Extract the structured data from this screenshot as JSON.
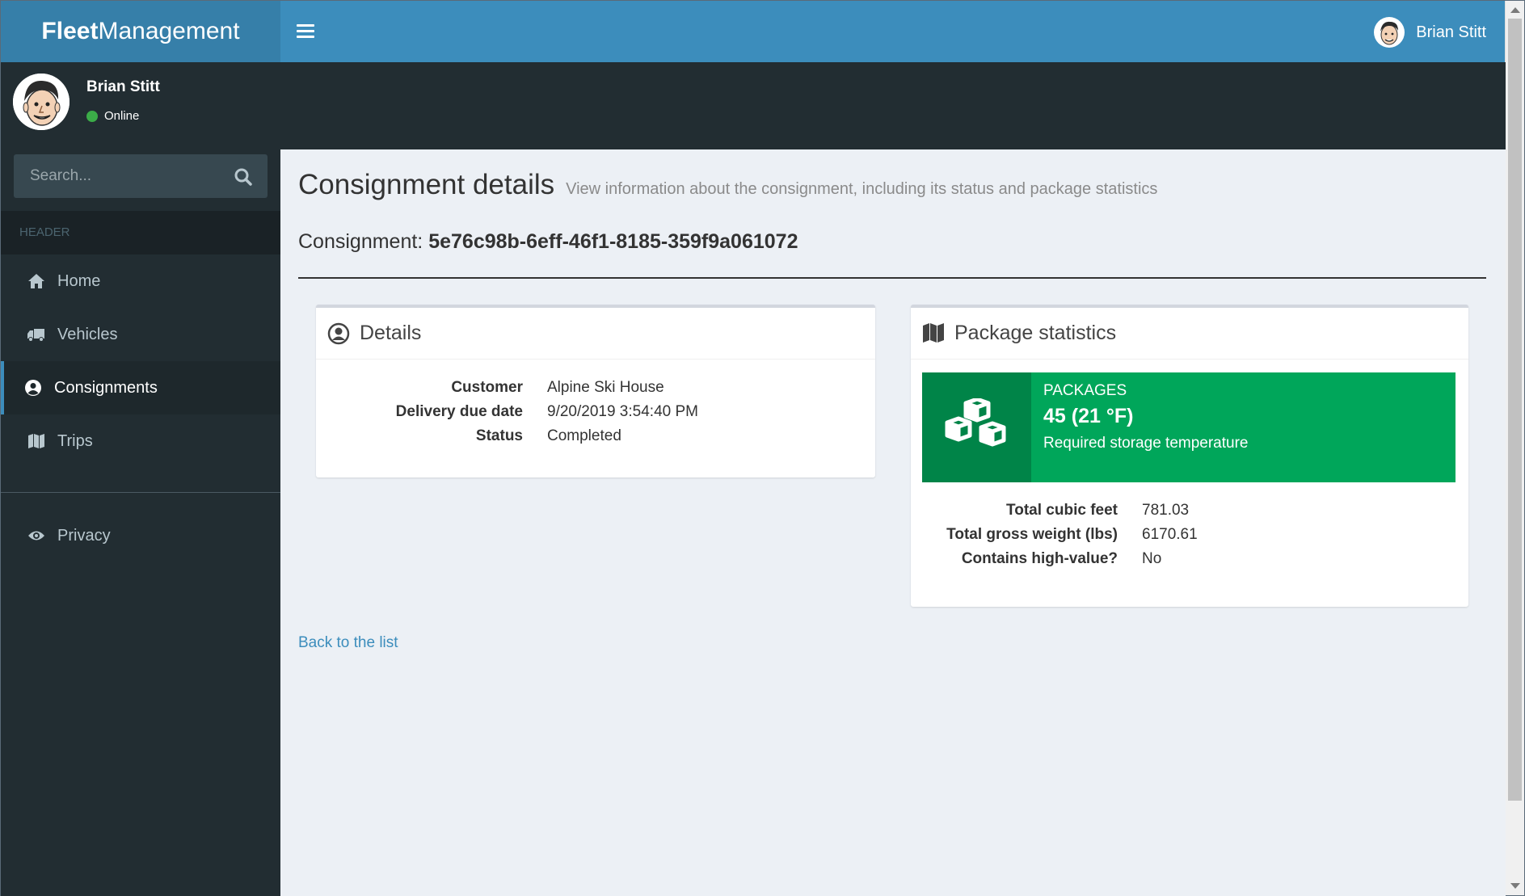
{
  "app": {
    "logo_bold": "Fleet",
    "logo_rest": "Management"
  },
  "header": {
    "user_name": "Brian Stitt",
    "menu_icon": "hamburger-icon"
  },
  "sidebar": {
    "user": {
      "name": "Brian Stitt",
      "status": "Online",
      "status_color": "#3bac48"
    },
    "search": {
      "placeholder": "Search..."
    },
    "header_label": "HEADER",
    "items": [
      {
        "label": "Home",
        "icon": "home-icon",
        "active": false
      },
      {
        "label": "Vehicles",
        "icon": "truck-icon",
        "active": false
      },
      {
        "label": "Consignments",
        "icon": "user-circle-icon",
        "active": true
      },
      {
        "label": "Trips",
        "icon": "map-icon",
        "active": false
      }
    ],
    "privacy": {
      "label": "Privacy",
      "icon": "eye-icon"
    }
  },
  "page": {
    "title": "Consignment details",
    "subtitle": "View information about the consignment, including its status and package statistics",
    "consignment_label": "Consignment:",
    "consignment_id": "5e76c98b-6eff-46f1-8185-359f9a061072"
  },
  "details": {
    "title": "Details",
    "rows": [
      {
        "label": "Customer",
        "value": "Alpine Ski House"
      },
      {
        "label": "Delivery due date",
        "value": "9/20/2019 3:54:40 PM"
      },
      {
        "label": "Status",
        "value": "Completed"
      }
    ]
  },
  "stats": {
    "title": "Package statistics",
    "info": {
      "label": "PACKAGES",
      "number": "45 (21 °F)",
      "desc": "Required storage temperature",
      "color": "#00a65a"
    },
    "rows": [
      {
        "label": "Total cubic feet",
        "value": "781.03"
      },
      {
        "label": "Total gross weight (lbs)",
        "value": "6170.61"
      },
      {
        "label": "Contains high-value?",
        "value": "No"
      }
    ]
  },
  "back_link": "Back to the list",
  "colors": {
    "header": "#3c8dbc",
    "logo_bg": "#367fa9",
    "sidebar": "#222d32",
    "accent": "#3c8dbc"
  }
}
